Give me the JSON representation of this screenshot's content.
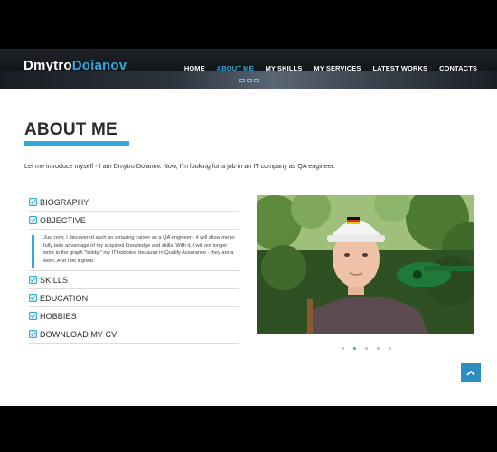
{
  "brand": {
    "first": "Dmytro",
    "last": "Doianov"
  },
  "nav": [
    {
      "label": "HOME",
      "active": false
    },
    {
      "label": "ABOUT ME",
      "active": true
    },
    {
      "label": "MY SKILLS",
      "active": false
    },
    {
      "label": "MY SERVICES",
      "active": false
    },
    {
      "label": "LATEST WORKS",
      "active": false
    },
    {
      "label": "CONTACTS",
      "active": false
    }
  ],
  "about": {
    "title": "ABOUT ME",
    "intro": "Let me introduce myself - I am Dmytro Doianov. Now, I'm looking for a job in an IT company as QA engineer."
  },
  "accordion": {
    "items": [
      {
        "label": "BIOGRAPHY"
      },
      {
        "label": "OBJECTIVE"
      },
      {
        "label": "SKILLS"
      },
      {
        "label": "EDUCATION"
      },
      {
        "label": "HOBBIES"
      },
      {
        "label": "DOWNLOAD MY CV"
      }
    ],
    "objective_text": "Just now, I discovered such an amazing career as a QA engineer - it will allow me to fully take advantage of my acquired knowledge and skills. With it, I will not longer write in the graph \"hobby\" my IT hobbies, because in Quality Assurance - they are a work. And I do it great."
  },
  "colors": {
    "accent": "#31a8d8",
    "header_bg": "#121518",
    "button_bg": "#2a8fc0"
  },
  "icons": {
    "check": "check-square-icon",
    "to_top": "chevron-up-icon"
  },
  "photo_carousel": {
    "dots": 5,
    "active_index": 1
  }
}
